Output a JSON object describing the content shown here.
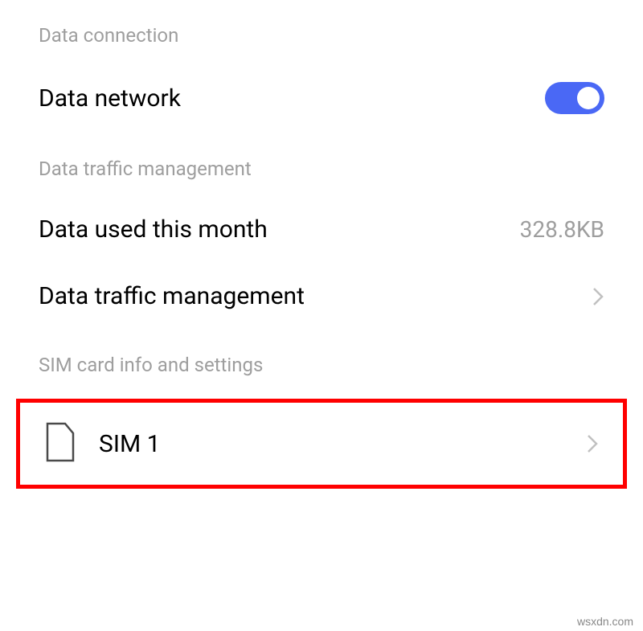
{
  "sections": {
    "data_connection": {
      "header": "Data connection",
      "items": {
        "data_network": {
          "label": "Data network",
          "toggle_on": true
        }
      }
    },
    "data_traffic": {
      "header": "Data traffic management",
      "items": {
        "data_used": {
          "label": "Data used this month",
          "value": "328.8KB"
        },
        "data_traffic_management": {
          "label": "Data traffic management"
        }
      }
    },
    "sim_card": {
      "header": "SIM card info and settings",
      "items": {
        "sim1": {
          "label": "SIM 1"
        }
      }
    }
  },
  "watermark": "wsxdn.com"
}
